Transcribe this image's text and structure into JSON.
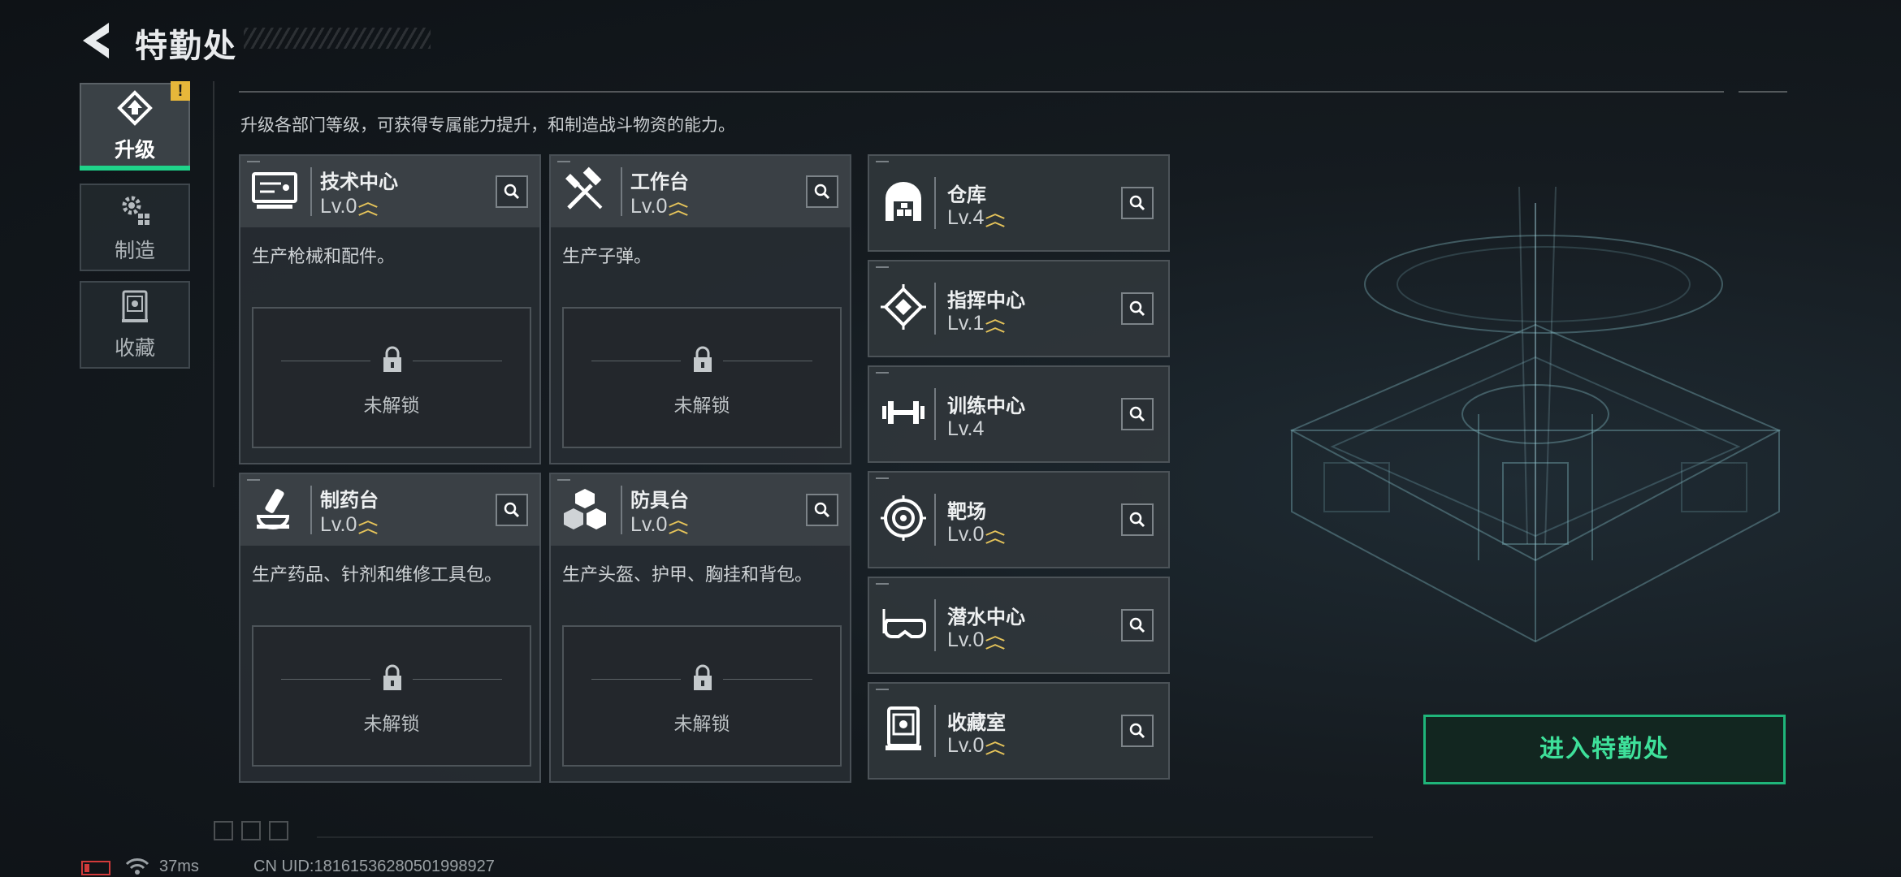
{
  "header": {
    "title": "特勤处"
  },
  "tabs": [
    {
      "label": "升级",
      "active": true,
      "alert": "!"
    },
    {
      "label": "制造",
      "active": false
    },
    {
      "label": "收藏",
      "active": false
    }
  ],
  "description": "升级各部门等级，可获得专属能力提升，和制造战斗物资的能力。",
  "locked_label": "未解锁",
  "big_cards": [
    {
      "name": "技术中心",
      "level": "Lv.0",
      "desc": "生产枪械和配件。",
      "icon": "tech-center-icon"
    },
    {
      "name": "工作台",
      "level": "Lv.0",
      "desc": "生产子弹。",
      "icon": "workbench-icon"
    },
    {
      "name": "制药台",
      "level": "Lv.0",
      "desc": "生产药品、针剂和维修工具包。",
      "icon": "pharmacy-icon"
    },
    {
      "name": "防具台",
      "level": "Lv.0",
      "desc": "生产头盔、护甲、胸挂和背包。",
      "icon": "armor-bench-icon"
    }
  ],
  "small_cards": [
    {
      "name": "仓库",
      "level": "Lv.4",
      "upgradable": true,
      "icon": "warehouse-icon"
    },
    {
      "name": "指挥中心",
      "level": "Lv.1",
      "upgradable": true,
      "icon": "command-center-icon"
    },
    {
      "name": "训练中心",
      "level": "Lv.4",
      "upgradable": false,
      "icon": "training-center-icon"
    },
    {
      "name": "靶场",
      "level": "Lv.0",
      "upgradable": true,
      "icon": "shooting-range-icon"
    },
    {
      "name": "潜水中心",
      "level": "Lv.0",
      "upgradable": true,
      "icon": "diving-center-icon"
    },
    {
      "name": "收藏室",
      "level": "Lv.0",
      "upgradable": true,
      "icon": "collection-room-icon"
    }
  ],
  "enter_button": "进入特勤处",
  "footer": {
    "ping": "37ms",
    "uid": "CN UID:18161536280501998927"
  },
  "colors": {
    "accent": "#1fd38a",
    "upgrade": "#e6c45a",
    "alert": "#e7b73a"
  }
}
